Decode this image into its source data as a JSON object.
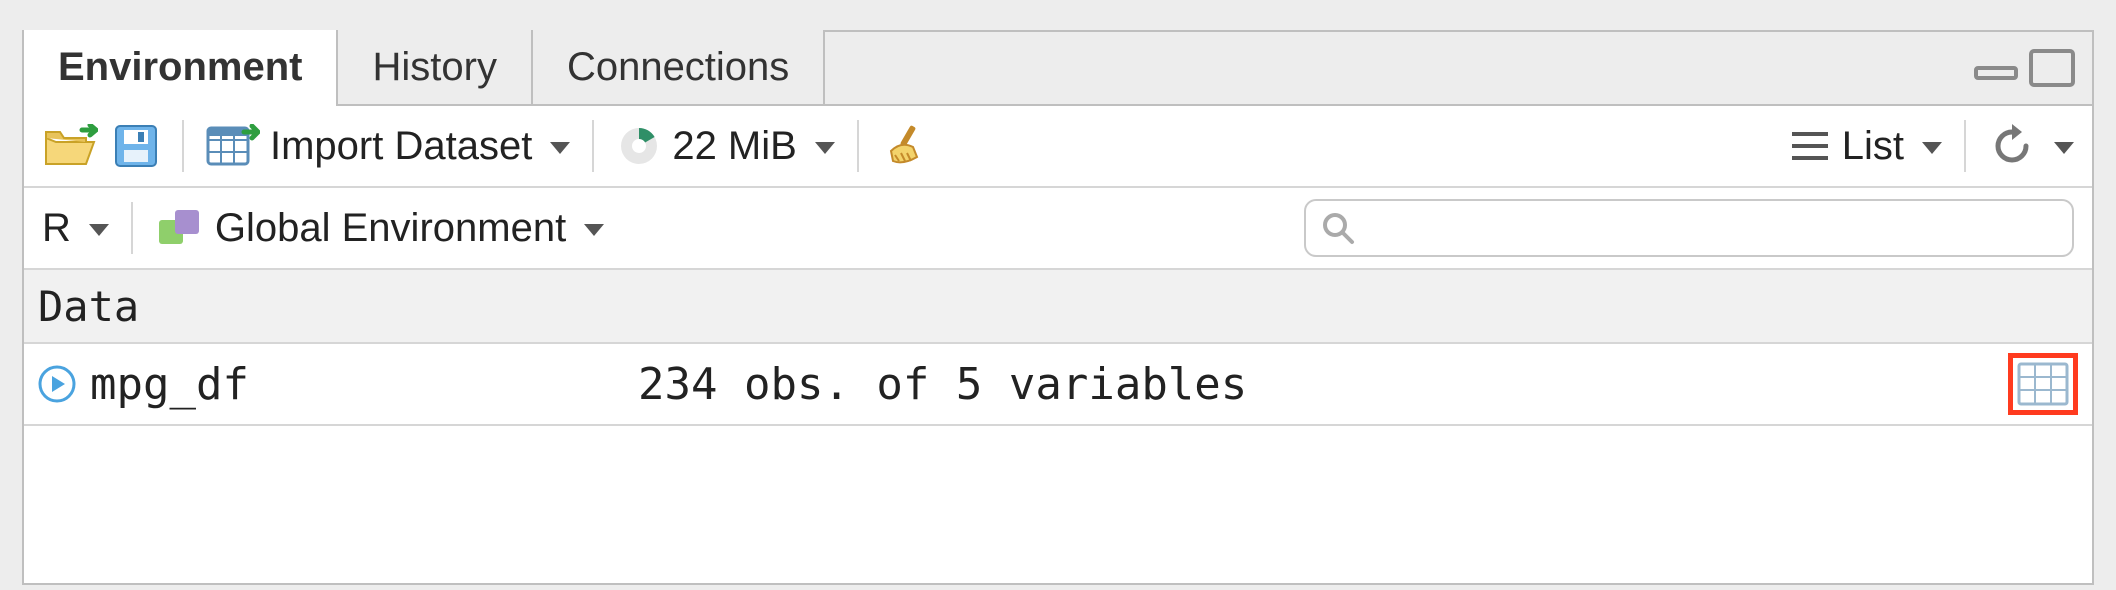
{
  "tabs": {
    "environment": "Environment",
    "history": "History",
    "connections": "Connections"
  },
  "toolbar": {
    "import_dataset_label": "Import Dataset",
    "memory_usage": "22 MiB",
    "view_mode": "List"
  },
  "toolbar2": {
    "language": "R",
    "scope": "Global Environment",
    "search_placeholder": ""
  },
  "section": {
    "data_header": "Data"
  },
  "objects": [
    {
      "name": "mpg_df",
      "description": "234 obs. of 5 variables"
    }
  ]
}
